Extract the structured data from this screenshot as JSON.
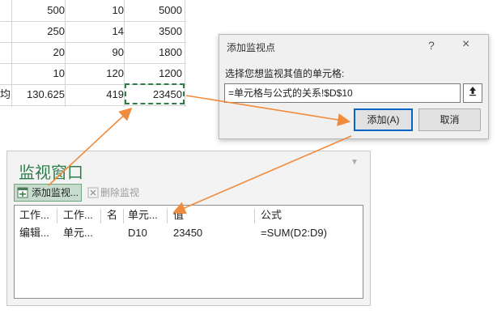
{
  "sheet": {
    "rows": [
      {
        "a": "",
        "b": "500",
        "c": "10",
        "d": "5000"
      },
      {
        "a": "",
        "b": "250",
        "c": "14",
        "d": "3500"
      },
      {
        "a": "",
        "b": "20",
        "c": "90",
        "d": "1800"
      },
      {
        "a": "",
        "b": "10",
        "c": "120",
        "d": "1200"
      },
      {
        "a": "均",
        "b": "130.625",
        "c": "419",
        "d": "23450"
      }
    ]
  },
  "dialog": {
    "title": "添加监视点",
    "help": "?",
    "close": "×",
    "prompt": "选择您想监视其值的单元格:",
    "input_value": "=单元格与公式的关系!$D$10",
    "add_label": "添加(A)",
    "cancel_label": "取消"
  },
  "watch": {
    "title": "监视窗口",
    "add_button": "添加监视...",
    "delete_button": "删除监视",
    "columns": [
      "工作...",
      "工作...",
      "名",
      "单元...",
      "值",
      "公式"
    ],
    "rows": [
      {
        "workbook": "编辑...",
        "sheet": "单元...",
        "name": "",
        "cell": "D10",
        "value": "23450",
        "formula": "=SUM(D2:D9)"
      }
    ]
  },
  "colors": {
    "accent_green": "#2e7d4a",
    "arrow": "#f08a3c",
    "default_button": "#0a64c8"
  }
}
